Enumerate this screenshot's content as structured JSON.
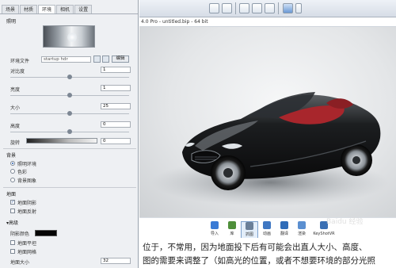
{
  "panel": {
    "tabs": [
      "场景",
      "材质",
      "环境",
      "相机",
      "设置"
    ],
    "active_tab": 2,
    "lighting": {
      "title": "照明",
      "env_file_label": "环境文件",
      "env_file_value": "startup hdr",
      "edit_label": "编辑"
    },
    "sliders": [
      {
        "label": "对比度",
        "value": "1",
        "level": 0.5
      },
      {
        "label": "亮度",
        "value": "1",
        "level": 0.5
      },
      {
        "label": "大小",
        "value": "25",
        "level": 0.5
      },
      {
        "label": "高度",
        "value": "0",
        "level": 0.5
      }
    ],
    "rotation": {
      "label": "旋转",
      "value": "0"
    },
    "background": {
      "title": "背景",
      "options": [
        "照明环境",
        "色彩",
        "背景图象"
      ],
      "selected": 0
    },
    "ground": {
      "title": "地面",
      "checkboxes": [
        {
          "label": "地面阴影",
          "checked": true
        },
        {
          "label": "地面反射",
          "checked": false
        }
      ],
      "advanced_title": "▾高级",
      "shadow_color_label": "阴影颜色",
      "shadow_color": "#050505",
      "more_checkboxes": [
        {
          "label": "地面平坦",
          "checked": false
        },
        {
          "label": "地面网格",
          "checked": false
        }
      ],
      "size_label": "地面大小",
      "size_value": "32"
    }
  },
  "viewport": {
    "title": "4.0 Pro  - untitled.bip  - 64 bit"
  },
  "bottom_toolbar": {
    "items": [
      {
        "label": "导入",
        "color": "#3a7bd5"
      },
      {
        "label": "库",
        "color": "#4f8f3a"
      },
      {
        "label": "抓图",
        "color": "#6a7f98"
      },
      {
        "label": "动画",
        "color": "#3f77c2"
      },
      {
        "label": "翻译",
        "color": "#2f6cb8"
      },
      {
        "label": "渲染",
        "color": "#5b8fd0"
      },
      {
        "label": "KeyShotVR",
        "color": "#3a6fb3"
      }
    ],
    "active_index": 2
  },
  "article": {
    "lines": [
      "位于，不常用，因为地面投下后有可能会出直人大小、高度、",
      "图的需要来调整了（如高光的位置，或者不想要环境的部分光照"
    ]
  },
  "watermark": "Baidu 经验"
}
